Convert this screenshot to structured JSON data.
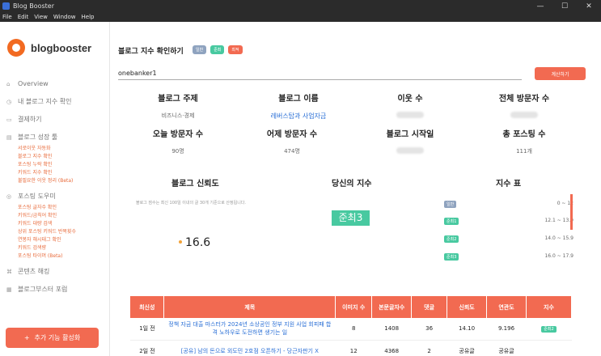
{
  "window": {
    "title": "Blog Booster",
    "controls": [
      "—",
      "☐",
      "✕"
    ]
  },
  "menu": [
    "File",
    "Edit",
    "View",
    "Window",
    "Help"
  ],
  "logo": {
    "text": "blogbooster"
  },
  "sidebar": {
    "items": [
      {
        "label": "Overview",
        "icon": "home-icon"
      },
      {
        "label": "내 블로그 지수 확인",
        "icon": "clock-icon"
      },
      {
        "label": "결제하기",
        "icon": "card-icon"
      },
      {
        "label": "블로그 성장 툴",
        "icon": "tools-icon",
        "subitems": [
          "서로이웃 자동화",
          "블로그 지수 확인",
          "포스팅 누락 확인",
          "키워드 지수 확인",
          "불필요한 이웃 정리 (Beta)"
        ]
      },
      {
        "label": "포스팅 도우미",
        "icon": "target-icon",
        "subitems": [
          "포스팅 글자수 확인",
          "키워드/금칙어 확인",
          "키워드 대량 검색",
          "상위 포스팅 키워드 반복횟수",
          "연봉자 해시태그 확인",
          "키워드 검색량",
          "포스팅 타이머 (Beta)"
        ]
      },
      {
        "label": "콘텐츠 해킹",
        "icon": "hack-icon"
      },
      {
        "label": "블로그부스터 포럼",
        "icon": "forum-icon"
      }
    ],
    "promo_label": "추가 기능 활성화"
  },
  "main": {
    "title": "블로그 지수 확인하기",
    "badges": [
      "일반",
      "준최",
      "최적"
    ],
    "search_value": "onebanker1",
    "calc_button": "계산하기",
    "stats": [
      {
        "label": "블로그 주제",
        "value": "비즈니스·경제"
      },
      {
        "label": "블로그 이름",
        "value": "레버스탑과 사업자금"
      },
      {
        "label": "이웃 수",
        "value": ""
      },
      {
        "label": "전체 방문자 수",
        "value": ""
      },
      {
        "label": "오늘 방문자 수",
        "value": "90명"
      },
      {
        "label": "어제 방문자 수",
        "value": "474명"
      },
      {
        "label": "블로그 시작일",
        "value": ""
      },
      {
        "label": "총 포스팅 수",
        "value": "111개"
      }
    ],
    "reliability": {
      "label": "블로그 신뢰도",
      "desc": "블로그 점수는 최신 100일 이내의 글 30개 기준으로 산정됩니다.",
      "value": "16.6"
    },
    "your_index": {
      "label": "당신의 지수",
      "value": "준최3"
    },
    "index_table": {
      "label": "지수 표",
      "rows": [
        {
          "tag": "일반",
          "range": "0 ~ 12",
          "color": "#8fa3bf"
        },
        {
          "tag": "준최1",
          "range": "12.1 ~ 13.9",
          "color": "#48c9a0"
        },
        {
          "tag": "준최2",
          "range": "14.0 ~ 15.9",
          "color": "#48c9a0"
        },
        {
          "tag": "준최3",
          "range": "16.0 ~ 17.9",
          "color": "#48c9a0"
        }
      ]
    },
    "posts": {
      "headers": [
        "최신성",
        "제목",
        "이미지 수",
        "본문글자수",
        "댓글",
        "신뢰도",
        "연관도",
        "지수"
      ],
      "rows": [
        [
          "1일 전",
          "정책 자금 대출 마스터가 2024년 소상공인 정부 지원 사업 회피패 합격 노하우로 도전하면 생기는 일",
          "8",
          "1408",
          "36",
          "14.10",
          "9.196",
          "준최2"
        ],
        [
          "2일 전",
          "[공유] 남의 돈으로 외도민 2호점 오픈하기 - 당근자판기 X",
          "12",
          "4368",
          "2",
          "공유글",
          "공유글",
          ""
        ]
      ]
    }
  }
}
